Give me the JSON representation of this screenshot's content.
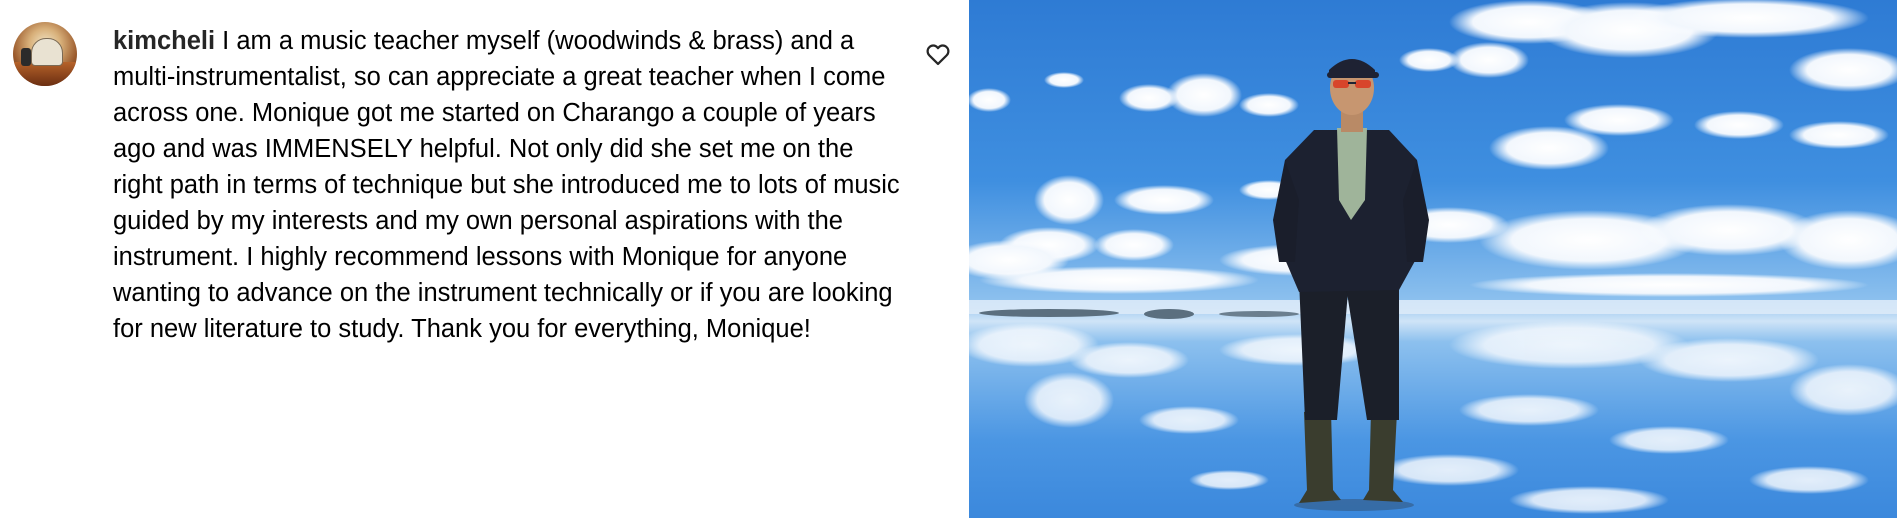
{
  "comment": {
    "username": "kimcheli",
    "text": " I am a music teacher myself (woodwinds & brass) and a multi-instrumentalist, so can appreciate a great teacher when I come across one. Monique got me started on Charango a couple of years ago and was IMMENSELY helpful. Not only did she set me on the right path in terms of technique but she introduced me to lots of music guided by my interests and my own personal aspirations with the instrument. I highly recommend lessons with Monique for anyone wanting to advance on the instrument technically or if you are looking for new literature to study. Thank you for everything, Monique!",
    "like_icon": "heart-outline-icon"
  },
  "colors": {
    "sky_top": "#2f7fd6",
    "sky_mid": "#5aa3ea",
    "horizon": "#b9d9f5",
    "text": "#000000",
    "username": "#262626"
  }
}
